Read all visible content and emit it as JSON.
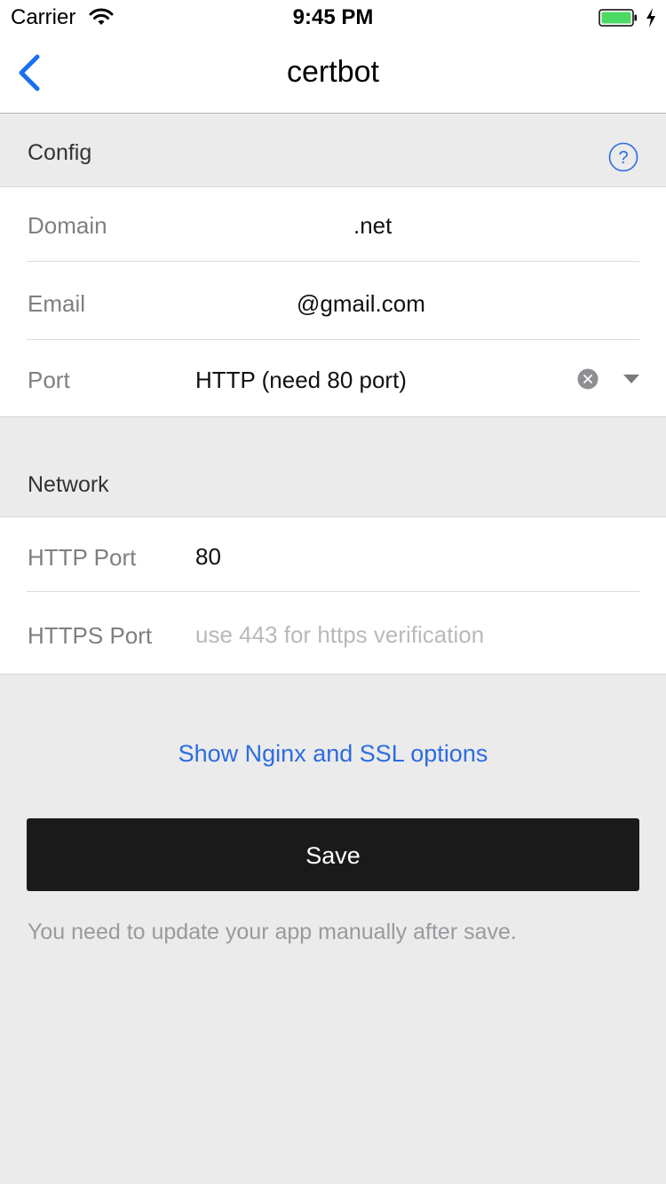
{
  "status_bar": {
    "carrier": "Carrier",
    "time": "9:45 PM",
    "battery_color": "#4cd964"
  },
  "nav": {
    "title": "certbot",
    "accent": "#1a73e8"
  },
  "config_section": {
    "title": "Config",
    "help_icon": "question-circle-icon",
    "rows": [
      {
        "label": "Domain",
        "value": ".net"
      },
      {
        "label": "Email",
        "value": "@gmail.com"
      },
      {
        "label": "Port",
        "value": "HTTP (need 80 port)"
      }
    ]
  },
  "network_section": {
    "title": "Network",
    "rows": [
      {
        "label": "HTTP Port",
        "value": "80"
      },
      {
        "label": "HTTPS Port",
        "value": "",
        "placeholder": "use 443 for https verification"
      }
    ]
  },
  "actions": {
    "show_options_link": "Show Nginx and SSL options",
    "save_label": "Save",
    "note": "You need to update your app manually after save."
  }
}
